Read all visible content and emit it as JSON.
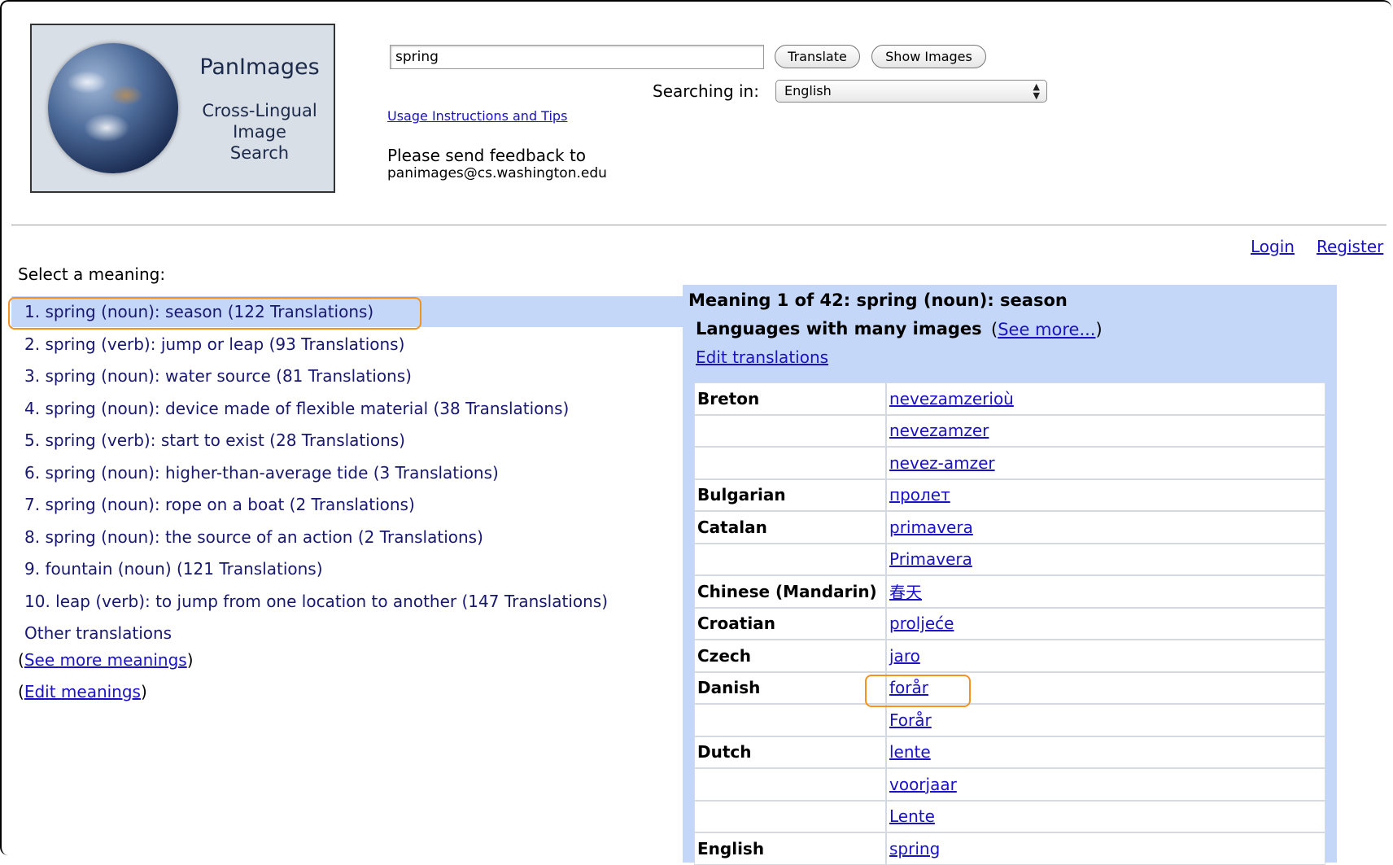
{
  "logo": {
    "title": "PanImages",
    "subtitle_lines": [
      "Cross-Lingual",
      "Image",
      "Search"
    ]
  },
  "search": {
    "value": "spring",
    "translate_label": "Translate",
    "show_images_label": "Show Images",
    "searching_in_label": "Searching in:",
    "language_selected": "English"
  },
  "usage_link": "Usage Instructions and Tips",
  "feedback": {
    "line1": "Please send feedback to",
    "email": "panimages@cs.washington.edu"
  },
  "auth": {
    "login": "Login",
    "register": "Register"
  },
  "meanings": {
    "label": "Select a meaning:",
    "items": [
      "1. spring (noun): season (122 Translations)",
      "2. spring (verb): jump or leap (93 Translations)",
      "3. spring (noun): water source (81 Translations)",
      "4. spring (noun): device made of flexible material (38 Translations)",
      "5. spring (verb): start to exist (28 Translations)",
      "6. spring (noun): higher-than-average tide (3 Translations)",
      "7. spring (noun): rope on a boat (2 Translations)",
      "8. spring (noun): the source of an action (2 Translations)",
      "9. fountain (noun) (121 Translations)",
      "10. leap (verb): to jump from one location to another (147 Translations)"
    ],
    "other_translations": "Other translations",
    "see_more_meanings": "See more meanings",
    "edit_meanings": "Edit meanings"
  },
  "panel": {
    "title": "Meaning 1 of 42: spring (noun): season",
    "languages_many_images": "Languages with many images",
    "see_more": "See more...",
    "edit_translations": "Edit translations",
    "rows": [
      {
        "lang": "Breton",
        "word": "nevezamzerioù"
      },
      {
        "lang": "",
        "word": "nevezamzer"
      },
      {
        "lang": "",
        "word": "nevez-amzer"
      },
      {
        "lang": "Bulgarian",
        "word": "пролет"
      },
      {
        "lang": "Catalan",
        "word": "primavera"
      },
      {
        "lang": "",
        "word": "Primavera"
      },
      {
        "lang": "Chinese (Mandarin)",
        "word": "春天"
      },
      {
        "lang": "Croatian",
        "word": "proljeće"
      },
      {
        "lang": "Czech",
        "word": "jaro"
      },
      {
        "lang": "Danish",
        "word": "forår"
      },
      {
        "lang": "",
        "word": "Forår"
      },
      {
        "lang": "Dutch",
        "word": "lente"
      },
      {
        "lang": "",
        "word": "voorjaar"
      },
      {
        "lang": "",
        "word": "Lente"
      },
      {
        "lang": "English",
        "word": "spring"
      }
    ]
  },
  "colors": {
    "selection_blue": "#c5d7f8",
    "highlight_orange": "#f5911e",
    "link_blue": "#1a12c4",
    "meaning_text": "#18186f"
  }
}
